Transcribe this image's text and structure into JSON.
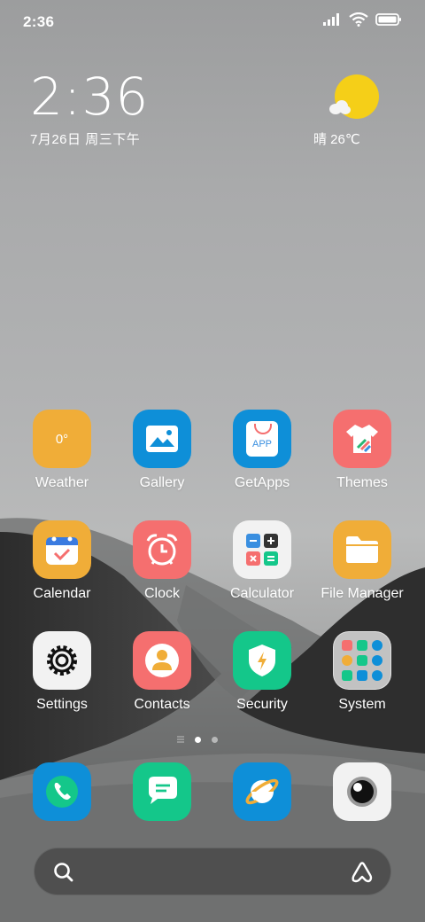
{
  "status_bar": {
    "time": "2:36"
  },
  "clock_widget": {
    "time": "2:36",
    "date": "7月26日 周三下午"
  },
  "weather_widget": {
    "summary": "晴 26℃",
    "icon": "sun-with-cloud-icon"
  },
  "apps": [
    {
      "label": "Weather",
      "icon": "weather-icon",
      "icon_text": "0°",
      "color": "#f0ad38"
    },
    {
      "label": "Gallery",
      "icon": "gallery-icon",
      "color": "#0e8fd8"
    },
    {
      "label": "GetApps",
      "icon": "getapps-icon",
      "icon_text": "APP",
      "color": "#0e8fd8"
    },
    {
      "label": "Themes",
      "icon": "themes-icon",
      "color": "#f56f6f"
    },
    {
      "label": "Calendar",
      "icon": "calendar-icon",
      "color": "#f0ad38"
    },
    {
      "label": "Clock",
      "icon": "clock-icon",
      "color": "#f56f6f"
    },
    {
      "label": "Calculator",
      "icon": "calculator-icon",
      "color": "#f2f2f2"
    },
    {
      "label": "File Manager",
      "icon": "folder-icon",
      "color": "#f0ad38"
    },
    {
      "label": "Settings",
      "icon": "settings-icon",
      "color": "#f2f2f2"
    },
    {
      "label": "Contacts",
      "icon": "contacts-icon",
      "color": "#f56f6f"
    },
    {
      "label": "Security",
      "icon": "security-icon",
      "color": "#14c78a"
    },
    {
      "label": "System",
      "icon": "system-folder-icon",
      "color": "#d9d9d9"
    }
  ],
  "page_indicator": {
    "pages": 2,
    "current": 1
  },
  "dock": [
    {
      "icon": "phone-icon",
      "color": "#0e8fd8"
    },
    {
      "icon": "messages-icon",
      "color": "#14c78a"
    },
    {
      "icon": "browser-icon",
      "color": "#0e8fd8"
    },
    {
      "icon": "camera-icon",
      "color": "#f2f2f2"
    }
  ],
  "search_bar": {
    "left_icon": "search-icon",
    "right_icon": "assistant-icon"
  }
}
